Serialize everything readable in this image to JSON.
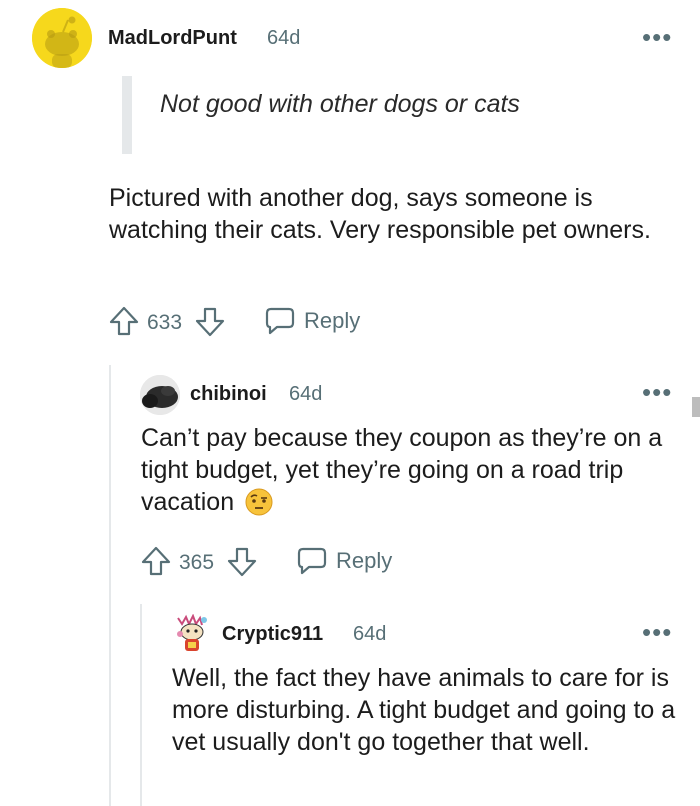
{
  "comments": [
    {
      "username": "MadLordPunt",
      "age": "64d",
      "quote": "Not good with other dogs or cats",
      "body": "Pictured with another dog, says someone is watching their cats. Very responsible pet owners.",
      "votes": "633",
      "reply_label": "Reply",
      "avatar_icon": "reddit-snoo-avatar-yellow"
    },
    {
      "username": "chibinoi",
      "age": "64d",
      "body": "Can’t pay because they coupon as they’re on a tight budget, yet they’re going on a road trip vacation",
      "emoji_icon": "raised-eyebrow-emoji",
      "votes": "365",
      "reply_label": "Reply",
      "avatar_icon": "dark-photo-avatar"
    },
    {
      "username": "Cryptic911",
      "age": "64d",
      "body": "Well, the fact they have animals to care for is more disturbing. A tight budget and going to a vet usually don't go together that well.",
      "avatar_icon": "snoo-costume-avatar"
    }
  ],
  "more_label": "•••",
  "colors": {
    "avatar_yellow": "#f6d81c",
    "meta_gray": "#576f76",
    "thread_line": "#e5e8ea"
  }
}
